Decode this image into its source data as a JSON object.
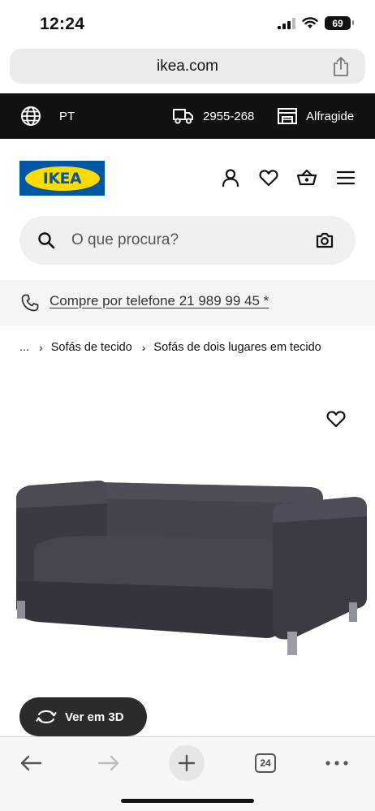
{
  "status": {
    "time": "12:24",
    "battery": "69"
  },
  "browser": {
    "url": "ikea.com",
    "tab_count": "24"
  },
  "top_bar": {
    "language": "PT",
    "delivery": "2955-268",
    "store": "Alfragide"
  },
  "header": {
    "logo_text": "IKEA"
  },
  "search": {
    "placeholder": "O que procura?"
  },
  "phone_banner": {
    "text": "Compre por telefone 21 989 99 45 *"
  },
  "breadcrumb": {
    "ellipsis": "...",
    "items": [
      "Sofás de tecido",
      "Sofás de dois lugares em tecido"
    ]
  },
  "product": {
    "view3d_label": "Ver em 3D"
  },
  "colors": {
    "brand_blue": "#0058a3",
    "brand_yellow": "#ffdb00",
    "top_bar_bg": "#111111",
    "sofa": "#3f4048"
  },
  "icons": [
    "globe-icon",
    "truck-icon",
    "store-icon",
    "account-icon",
    "heart-icon",
    "basket-icon",
    "menu-icon",
    "search-icon",
    "camera-icon",
    "phone-icon",
    "rotate-3d-icon",
    "back-arrow-icon",
    "forward-arrow-icon",
    "plus-icon",
    "more-icon",
    "share-icon"
  ]
}
